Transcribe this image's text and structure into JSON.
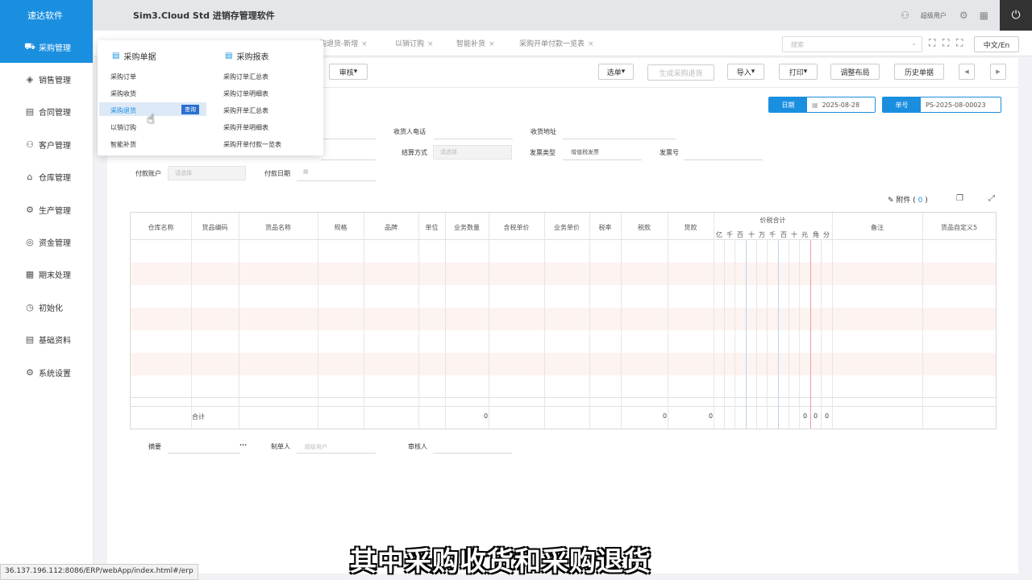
{
  "app": {
    "brand": "速达软件",
    "title": "Sim3.Cloud Std 进销存管理软件",
    "user": "超级用户",
    "lang_button": "中文/En"
  },
  "search": {
    "placeholder": "搜索"
  },
  "sidebar": {
    "items": [
      {
        "label": "采购管理",
        "icon": "cart-icon",
        "active": true
      },
      {
        "label": "销售管理",
        "icon": "tag-icon"
      },
      {
        "label": "合同管理",
        "icon": "contract-icon"
      },
      {
        "label": "客户管理",
        "icon": "customer-icon"
      },
      {
        "label": "仓库管理",
        "icon": "warehouse-icon"
      },
      {
        "label": "生产管理",
        "icon": "production-icon"
      },
      {
        "label": "资金管理",
        "icon": "money-icon"
      },
      {
        "label": "期末处理",
        "icon": "calendar-icon"
      },
      {
        "label": "初始化",
        "icon": "init-icon"
      },
      {
        "label": "基础资料",
        "icon": "document-icon"
      },
      {
        "label": "系统设置",
        "icon": "gear-icon"
      }
    ]
  },
  "tabs": [
    "购退货-新增",
    "以销订购",
    "智能补货",
    "采购开单付款一览表"
  ],
  "toolbar": {
    "audit": "审核",
    "select_doc": "选单",
    "generate_return": "生成采购退货",
    "import": "导入",
    "print": "打印",
    "adjust_layout": "调整布局",
    "history": "历史单据",
    "prev": "◀",
    "next": "▶"
  },
  "header_fields": {
    "date_label": "日期",
    "date_value": "2025-08-28",
    "number_label": "单号",
    "number_value": "PS-2025-08-00023"
  },
  "form": {
    "receiver_phone": "收货人电话",
    "receiver_address": "收货地址",
    "settlement": "结算方式",
    "settlement_placeholder": "请选择",
    "invoice_type": "发票类型",
    "invoice_type_value": "增值税发票",
    "invoice_no": "发票号",
    "pay_account": "付款账户",
    "pay_account_placeholder": "请选择",
    "pay_date": "付款日期"
  },
  "attachment": {
    "label": "附件",
    "count": "0"
  },
  "grid": {
    "columns": [
      "仓库名称",
      "货品编码",
      "货品名称",
      "规格",
      "品牌",
      "单位",
      "业务数量",
      "含税单价",
      "业务单价",
      "税率",
      "税款",
      "货款",
      "价税合计",
      "备注",
      "货品自定义5"
    ],
    "digits": [
      "亿",
      "千",
      "百",
      "十",
      "万",
      "千",
      "百",
      "十",
      "元",
      "角",
      "分"
    ],
    "footer": {
      "label": "合计",
      "qty": "0",
      "tax": "0",
      "goods": "0",
      "total_yuan": "0",
      "total_jiao": "0",
      "total_fen": "0"
    }
  },
  "bottom": {
    "summary": "摘要",
    "summary_more": "...",
    "maker": "制单人",
    "maker_value": "超级用户",
    "auditor": "审核人"
  },
  "dropdown": {
    "col1_title": "采购单据",
    "col1_items": [
      "采购订单",
      "采购收货",
      "采购退货",
      "以销订购",
      "智能补货"
    ],
    "col2_title": "采购报表",
    "col2_items": [
      "采购订单汇总表",
      "采购订单明细表",
      "采购开单汇总表",
      "采购开单明细表",
      "采购开单付款一览表"
    ],
    "tip": "查询"
  },
  "status_url": "36.137.196.112:8086/ERP/webApp/index.html#/erp",
  "subtitle": "其中采购收货和采购退货",
  "colors": {
    "accent": "#1a8fe0",
    "stripe": "#fdf3f0"
  }
}
